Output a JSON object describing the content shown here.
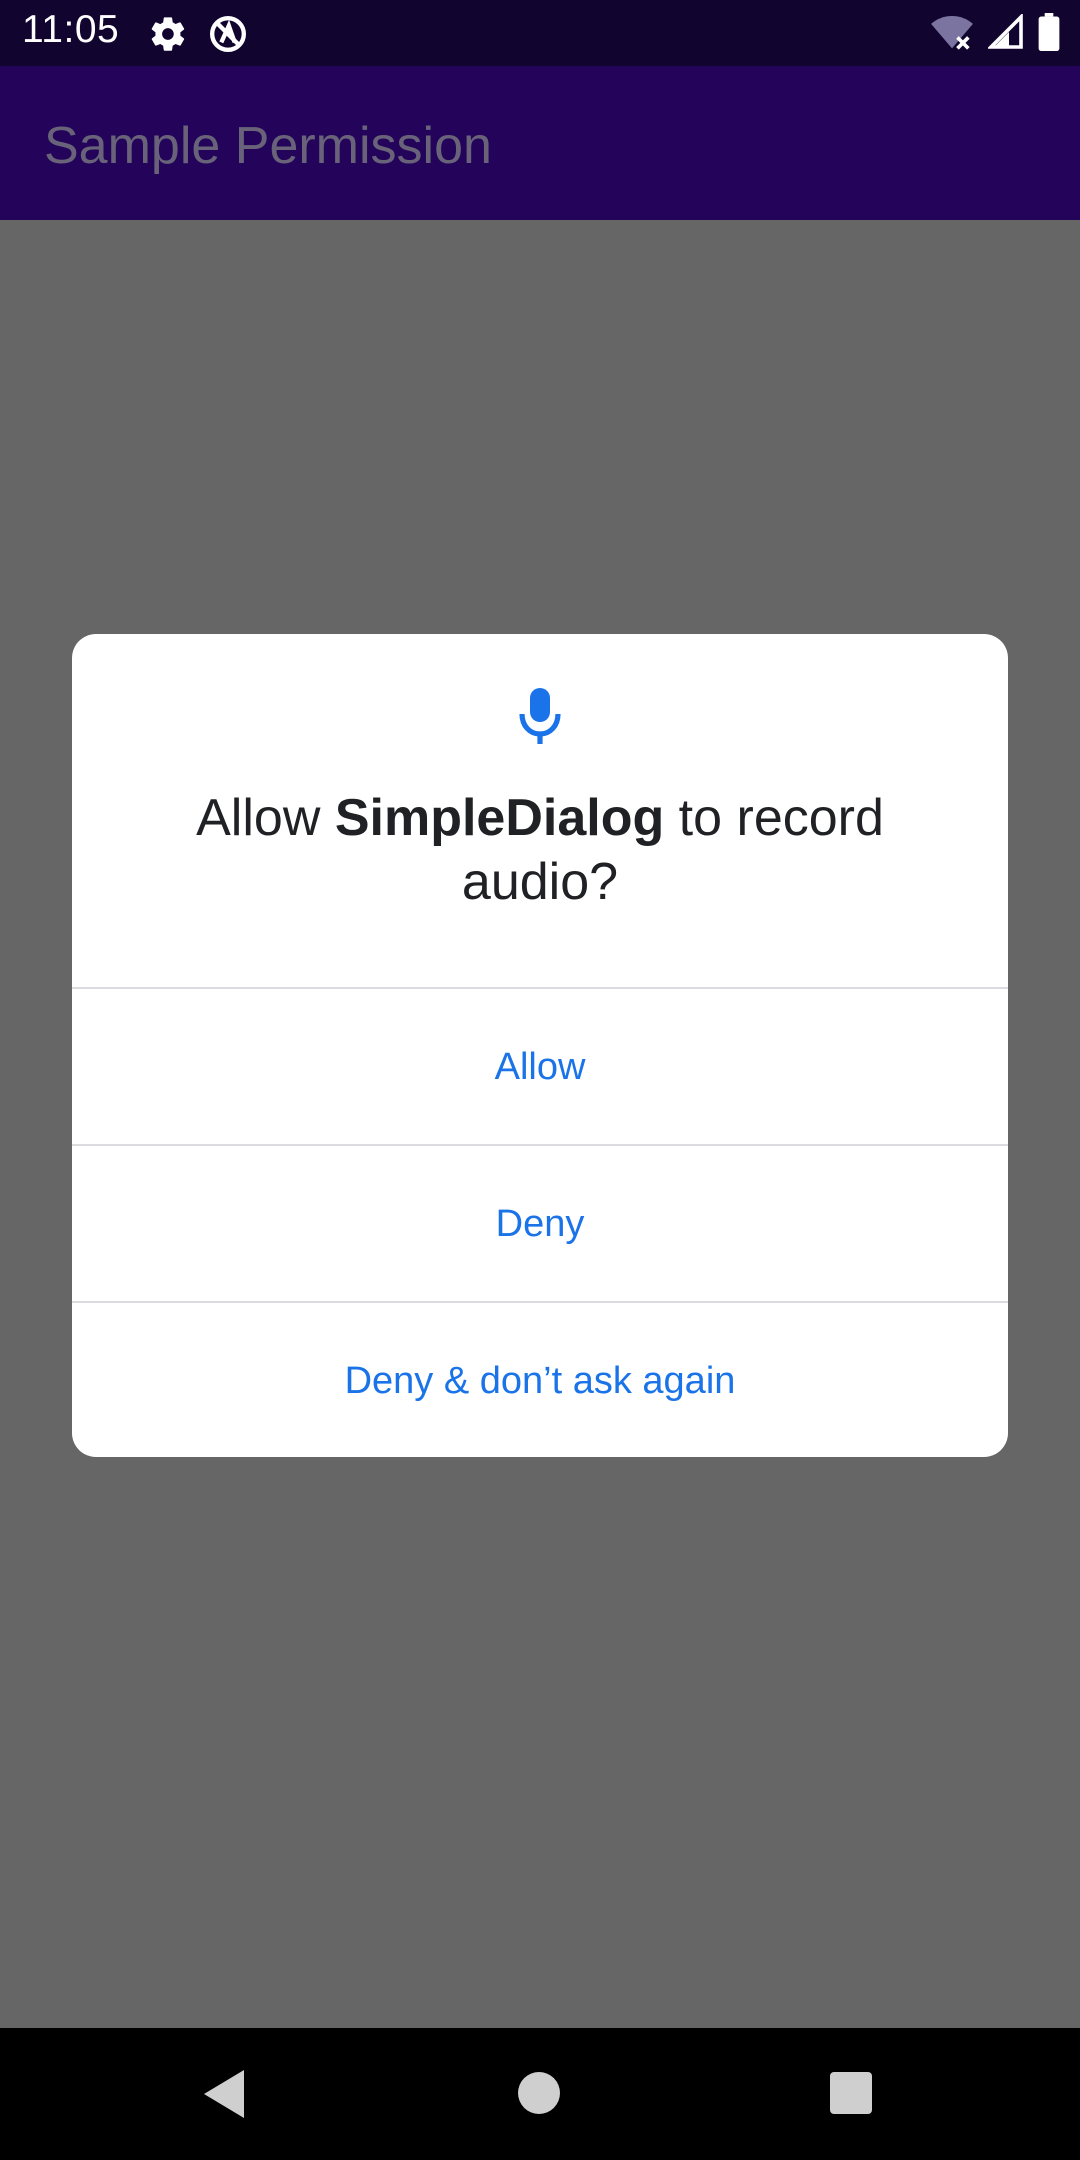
{
  "status_bar": {
    "time": "11:05",
    "icons": [
      "settings-icon",
      "circle-a-icon",
      "wifi-off-icon",
      "signal-icon",
      "battery-icon"
    ]
  },
  "app_bar": {
    "title": "Sample Permission"
  },
  "dialog": {
    "icon": "microphone-icon",
    "title_prefix": "Allow ",
    "title_app": "SimpleDialog",
    "title_suffix": " to record audio?",
    "options": {
      "allow": "Allow",
      "deny": "Deny",
      "deny_never": "Deny & don’t ask again"
    }
  },
  "nav_bar": {
    "icons": [
      "back-icon",
      "home-icon",
      "recents-icon"
    ]
  },
  "colors": {
    "status_bar": "#110530",
    "app_bar": "#24035a",
    "scrim": "#666666",
    "accent": "#1a73e8"
  }
}
